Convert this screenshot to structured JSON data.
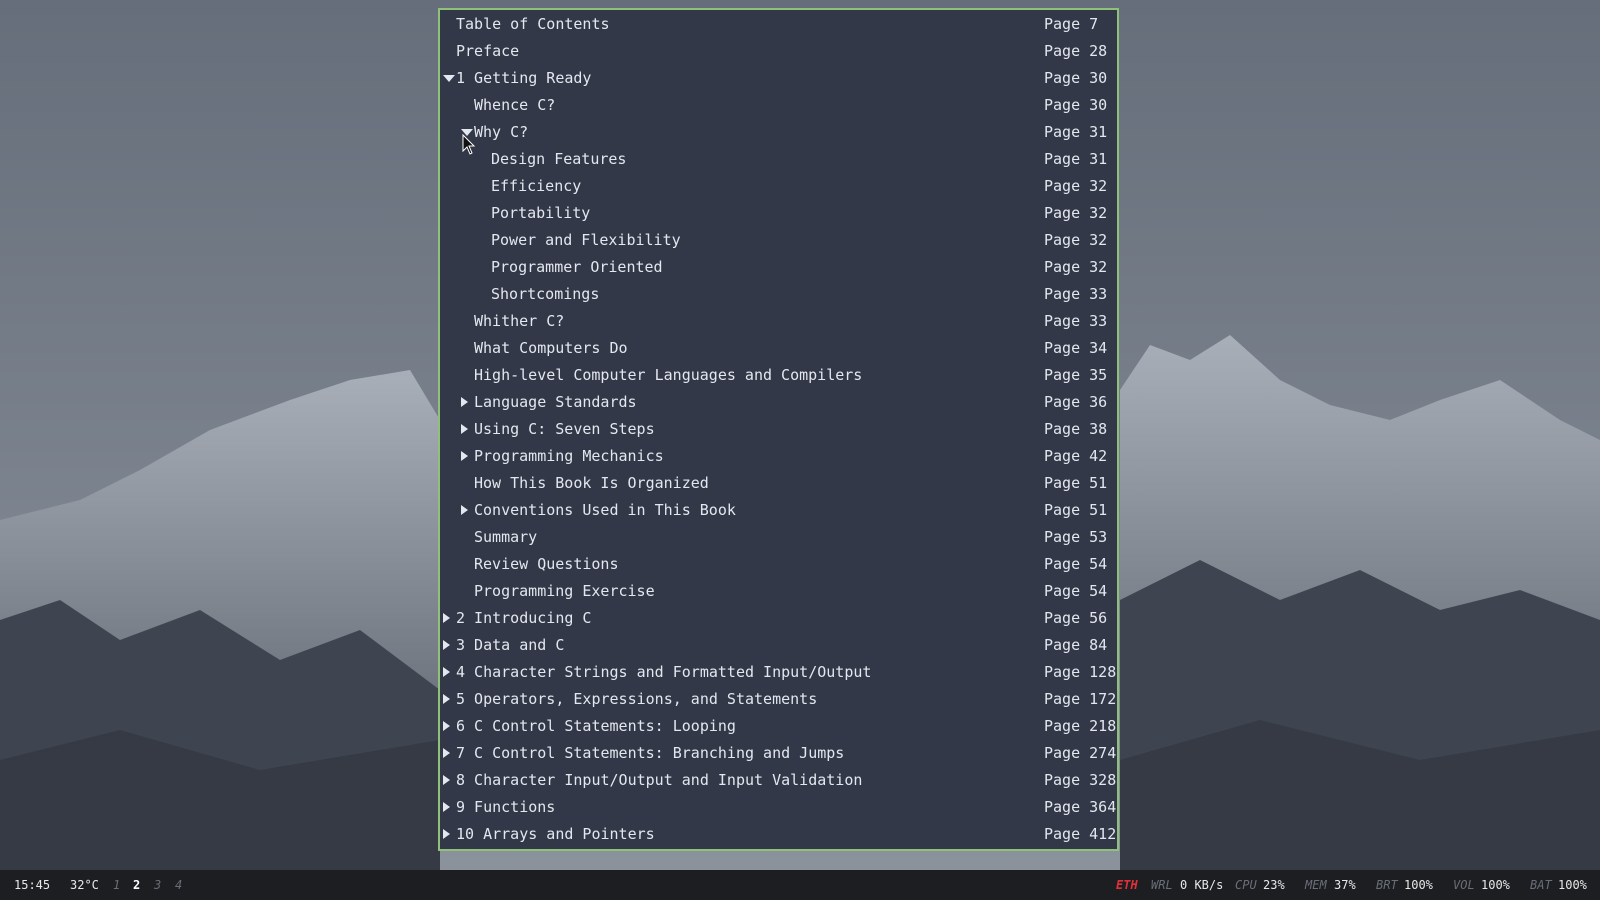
{
  "toc": {
    "rows": [
      {
        "title": "Table of Contents",
        "page": "Page 7",
        "level": 0,
        "arrow": "none"
      },
      {
        "title": "Preface",
        "page": "Page 28",
        "level": 0,
        "arrow": "none"
      },
      {
        "title": "1 Getting Ready",
        "page": "Page 30",
        "level": 0,
        "arrow": "down"
      },
      {
        "title": "Whence C?",
        "page": "Page 30",
        "level": 1,
        "arrow": "none"
      },
      {
        "title": "Why C?",
        "page": "Page 31",
        "level": 1,
        "arrow": "down"
      },
      {
        "title": "Design Features",
        "page": "Page 31",
        "level": 2,
        "arrow": "none"
      },
      {
        "title": "Efficiency",
        "page": "Page 32",
        "level": 2,
        "arrow": "none"
      },
      {
        "title": "Portability",
        "page": "Page 32",
        "level": 2,
        "arrow": "none"
      },
      {
        "title": "Power and Flexibility",
        "page": "Page 32",
        "level": 2,
        "arrow": "none"
      },
      {
        "title": "Programmer Oriented",
        "page": "Page 32",
        "level": 2,
        "arrow": "none"
      },
      {
        "title": "Shortcomings",
        "page": "Page 33",
        "level": 2,
        "arrow": "none"
      },
      {
        "title": "Whither C?",
        "page": "Page 33",
        "level": 1,
        "arrow": "none"
      },
      {
        "title": "What Computers Do",
        "page": "Page 34",
        "level": 1,
        "arrow": "none"
      },
      {
        "title": "High-level Computer Languages and Compilers",
        "page": "Page 35",
        "level": 1,
        "arrow": "none"
      },
      {
        "title": "Language Standards",
        "page": "Page 36",
        "level": 1,
        "arrow": "right"
      },
      {
        "title": "Using C: Seven Steps",
        "page": "Page 38",
        "level": 1,
        "arrow": "right"
      },
      {
        "title": "Programming Mechanics",
        "page": "Page 42",
        "level": 1,
        "arrow": "right"
      },
      {
        "title": "How This Book Is Organized",
        "page": "Page 51",
        "level": 1,
        "arrow": "none"
      },
      {
        "title": "Conventions Used in This Book",
        "page": "Page 51",
        "level": 1,
        "arrow": "right"
      },
      {
        "title": "Summary",
        "page": "Page 53",
        "level": 1,
        "arrow": "none"
      },
      {
        "title": "Review Questions",
        "page": "Page 54",
        "level": 1,
        "arrow": "none"
      },
      {
        "title": "Programming Exercise",
        "page": "Page 54",
        "level": 1,
        "arrow": "none"
      },
      {
        "title": "2 Introducing C",
        "page": "Page 56",
        "level": 0,
        "arrow": "right"
      },
      {
        "title": "3 Data and C",
        "page": "Page 84",
        "level": 0,
        "arrow": "right"
      },
      {
        "title": "4 Character Strings and Formatted Input/Output",
        "page": "Page 128",
        "level": 0,
        "arrow": "right"
      },
      {
        "title": "5 Operators, Expressions, and Statements",
        "page": "Page 172",
        "level": 0,
        "arrow": "right"
      },
      {
        "title": "6 C Control Statements: Looping",
        "page": "Page 218",
        "level": 0,
        "arrow": "right"
      },
      {
        "title": "7 C Control Statements: Branching and Jumps",
        "page": "Page 274",
        "level": 0,
        "arrow": "right"
      },
      {
        "title": "8 Character Input/Output and Input Validation",
        "page": "Page 328",
        "level": 0,
        "arrow": "right"
      },
      {
        "title": "9 Functions",
        "page": "Page 364",
        "level": 0,
        "arrow": "right"
      },
      {
        "title": "10 Arrays and Pointers",
        "page": "Page 412",
        "level": 0,
        "arrow": "right"
      }
    ]
  },
  "statusbar": {
    "time": "15:45",
    "temperature": "32°C",
    "workspaces": [
      "1",
      "2",
      "3",
      "4"
    ],
    "active_workspace": "2",
    "eth_label": "ETH",
    "wrl_label": "WRL",
    "wrl_value": "0 KB/s",
    "cpu_label": "CPU",
    "cpu_value": "23%",
    "mem_label": "MEM",
    "mem_value": "37%",
    "brt_label": "BRT",
    "brt_value": "100%",
    "vol_label": "VOL",
    "vol_value": "100%",
    "bat_label": "BAT",
    "bat_value": "100%"
  },
  "colors": {
    "panel_bg": "#323847",
    "panel_border": "#8fc17a",
    "text": "#e3e7ef",
    "eth_alert": "#e0303a",
    "statusbar_bg": "#1c1e22"
  }
}
